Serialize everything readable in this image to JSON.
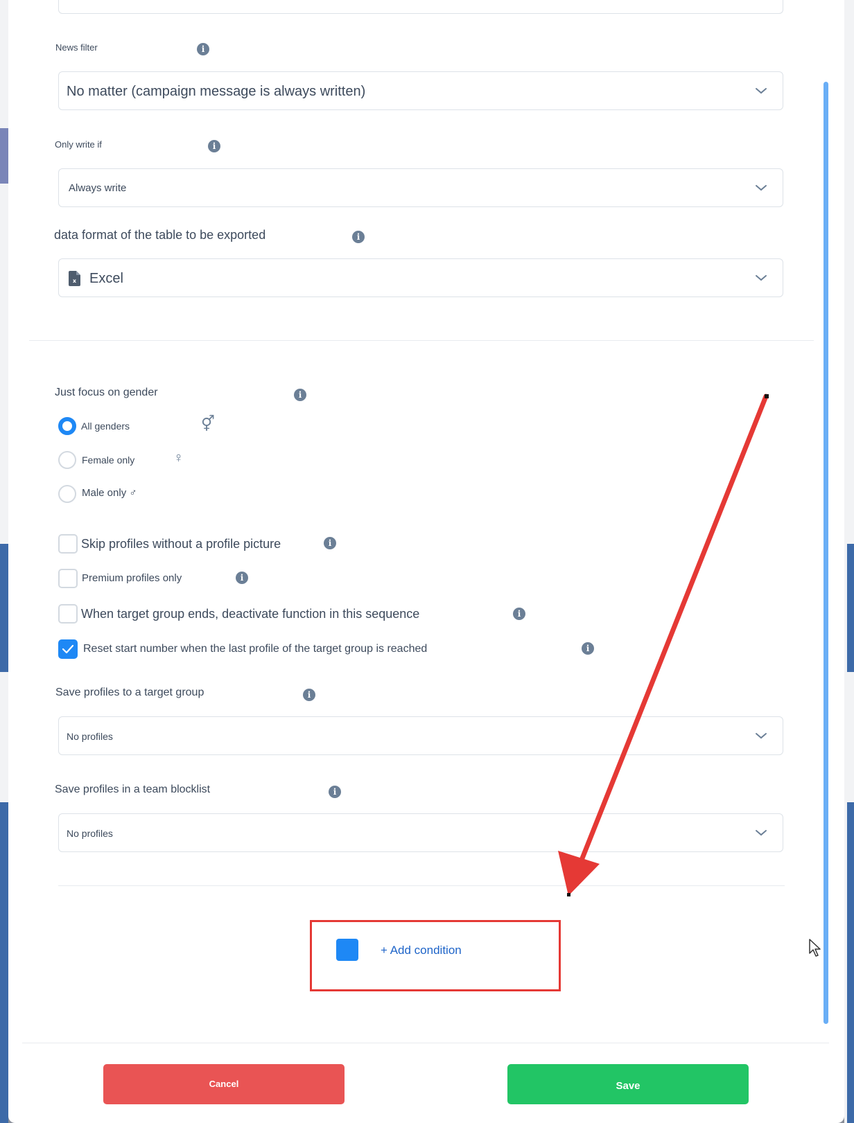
{
  "fields": {
    "news_filter": {
      "label": "News filter",
      "value": "No matter (campaign message is always written)"
    },
    "only_write_if": {
      "label": "Only write if",
      "value": "Always write"
    },
    "data_format": {
      "label": "data format of the table to be exported",
      "value": "Excel"
    }
  },
  "gender": {
    "label": "Just focus on gender",
    "options": [
      {
        "label": "All genders",
        "symbol": "⚥",
        "selected": true
      },
      {
        "label": "Female only",
        "symbol": "♀",
        "selected": false
      },
      {
        "label": "Male only ♂",
        "selected": false
      }
    ]
  },
  "checkboxes": [
    {
      "label": "Skip profiles without a profile picture",
      "checked": false
    },
    {
      "label": "Premium profiles only",
      "checked": false
    },
    {
      "label": "When target group ends, deactivate function in this sequence",
      "checked": false
    },
    {
      "label": "Reset start number when the last profile of the target group is reached",
      "checked": true
    }
  ],
  "save_target_group": {
    "label": "Save profiles to a target group",
    "value": "No profiles"
  },
  "save_blocklist": {
    "label": "Save profiles in a team blocklist",
    "value": "No profiles"
  },
  "add_condition": {
    "label": "+ Add condition"
  },
  "footer": {
    "cancel_label": "Cancel",
    "save_label": "Save"
  },
  "colors": {
    "accent": "#1e88f5",
    "cancel": "#e95454",
    "save": "#22c565",
    "annotation": "#e53935"
  },
  "icons": {
    "info": "info-icon",
    "chevron": "chevron-down-icon",
    "file": "excel-file-icon"
  }
}
